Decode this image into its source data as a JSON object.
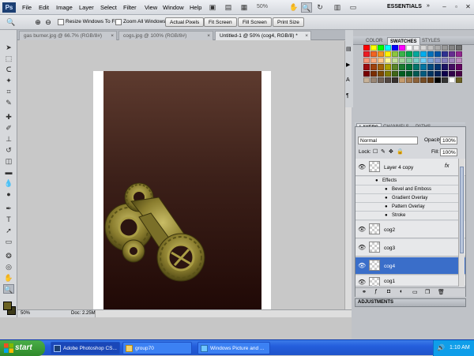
{
  "menubar": {
    "logo": "Ps",
    "items": [
      "File",
      "Edit",
      "Image",
      "Layer",
      "Select",
      "Filter",
      "View",
      "Window",
      "Help"
    ],
    "zoom": "50%",
    "workspace": "ESSENTIALS"
  },
  "options": {
    "resize_windows": "Resize Windows To Fit",
    "zoom_all_windows": "Zoom All Windows",
    "actual_pixels": "Actual Pixels",
    "fit_screen": "Fit Screen",
    "fill_screen": "Fill Screen",
    "print_size": "Print Size"
  },
  "tabs": [
    {
      "label": "gas burner.jpg @ 66.7% (RGB/8#)"
    },
    {
      "label": "cogs.jpg @ 100% (RGB/8#)"
    },
    {
      "label": "Untitled-1 @ 50% (cog4, RGB/8) *"
    }
  ],
  "status": {
    "zoom": "50%",
    "doc": "Doc: 2.25M/8.63M"
  },
  "swatch_panel": {
    "tabs": [
      "COLOR",
      "SWATCHES",
      "STYLES"
    ]
  },
  "layers_panel": {
    "tabs": [
      "LAYERS",
      "CHANNELS",
      "PATHS"
    ],
    "blend_mode": "Normal",
    "opacity_label": "Opacity:",
    "opacity": "100%",
    "lock_label": "Lock:",
    "fill_label": "Fill:",
    "fill": "100%",
    "layers": [
      {
        "name": "Layer 4 copy"
      },
      {
        "name": "cog2"
      },
      {
        "name": "cog3"
      },
      {
        "name": "cog4"
      },
      {
        "name": "cog1"
      }
    ],
    "effects_label": "Effects",
    "effects": [
      "Bevel and Emboss",
      "Gradient Overlay",
      "Pattern Overlay",
      "Stroke"
    ],
    "fx": "fx"
  },
  "adjustments": {
    "label": "ADJUSTMENTS"
  },
  "colors": {
    "foreground": "#6b6223",
    "background": "#3d3a1a",
    "selection": "#3a6ec9"
  },
  "taskbar": {
    "start": "start",
    "tasks": [
      "Adobe Photoshop CS...",
      "group70",
      "Windows Picture and ..."
    ],
    "time": "1:10 AM"
  }
}
